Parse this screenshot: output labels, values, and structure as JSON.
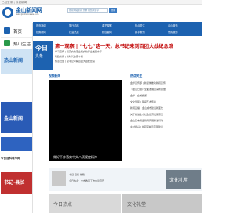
{
  "topbar": {
    "text": "已经登录 | 我们新闻"
  },
  "logo": {
    "name": "金山新闻网",
    "sub": "www.jinshannews.com"
  },
  "search": {
    "placeholder": "搜索网站新闻 文章 网络关键字",
    "button": "搜索"
  },
  "nav": {
    "row1": [
      "首页新闻",
      "旅行动态",
      "曲艺观察",
      "热点关注",
      "金山政务"
    ],
    "row2": [
      "视频新闻",
      "社会热点",
      "综合要闻",
      "数字报刊",
      "便民服务"
    ]
  },
  "sidebar": {
    "items": [
      {
        "label": "首页"
      },
      {
        "label": "热山生活"
      }
    ],
    "banner": "热山新闻",
    "ad_blue": "金山新闻",
    "hint": "今日百科城市网",
    "ad_red": "书记·县长"
  },
  "today": {
    "title": "今日",
    "sub": "头条"
  },
  "headline": "第一观察 | “七七”这一天，总书记来到百团大战纪念馆",
  "news": [
    "学习宣传 | 提高文化事业和文化产业发展水平",
    "时政新闻 | 新时代的奋斗者",
    "热点社会 | 总书记考察百团大战纪念馆"
  ],
  "section": {
    "title": "视频新闻"
  },
  "video": {
    "caption": "做好不作落实中央八项规定精神"
  },
  "right": {
    "title": "热点关注",
    "items": [
      "金华宣传部 | 新媒体推动新闻宣传",
      "《金山日报》全面发展迎来新篇章",
      "金华 · 全域旅游",
      "文化惠民 | 民间艺术传承",
      "新闻直播：金山城市建设新变化",
      "关于推进全市社会经济发展意见",
      "金山区市场监管局开展整治行动",
      "乡村振兴 | 共同富裕示范区建设"
    ]
  },
  "bottom": {
    "lines": [
      "书记 县长 信箱",
      "今日热点：全市教育工作会议召开"
    ],
    "right_img": "文化礼堂"
  },
  "footer": {
    "left": "今日热点",
    "right": "文化礼堂"
  }
}
